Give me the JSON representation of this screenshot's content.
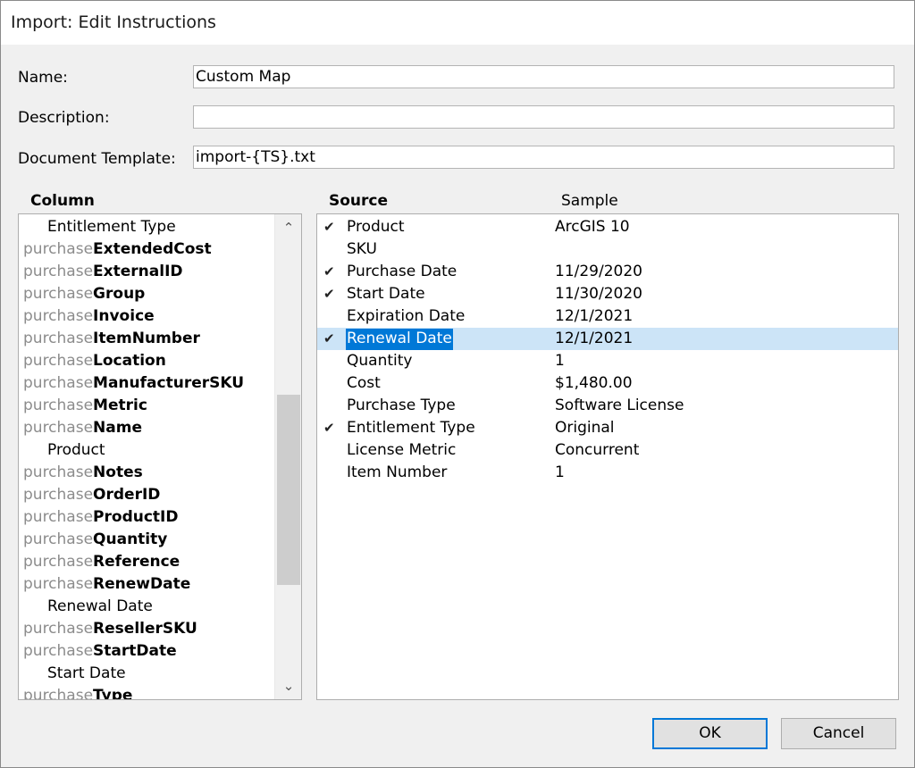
{
  "window": {
    "title": "Import: Edit Instructions"
  },
  "form": {
    "name_label": "Name:",
    "name_value": "Custom Map",
    "description_label": "Description:",
    "description_value": "",
    "template_label": "Document Template:",
    "template_value": "import-{TS}.txt"
  },
  "headers": {
    "column": "Column",
    "source": "Source",
    "sample": "Sample"
  },
  "column_list": [
    {
      "prefix": "",
      "field": "",
      "child": "Entitlement Type"
    },
    {
      "prefix": "purchase",
      "field": "ExtendedCost",
      "child": ""
    },
    {
      "prefix": "purchase",
      "field": "ExternalID",
      "child": ""
    },
    {
      "prefix": "purchase",
      "field": "Group",
      "child": ""
    },
    {
      "prefix": "purchase",
      "field": "Invoice",
      "child": ""
    },
    {
      "prefix": "purchase",
      "field": "ItemNumber",
      "child": ""
    },
    {
      "prefix": "purchase",
      "field": "Location",
      "child": ""
    },
    {
      "prefix": "purchase",
      "field": "ManufacturerSKU",
      "child": ""
    },
    {
      "prefix": "purchase",
      "field": "Metric",
      "child": ""
    },
    {
      "prefix": "purchase",
      "field": "Name",
      "child": ""
    },
    {
      "prefix": "",
      "field": "",
      "child": "Product"
    },
    {
      "prefix": "purchase",
      "field": "Notes",
      "child": ""
    },
    {
      "prefix": "purchase",
      "field": "OrderID",
      "child": ""
    },
    {
      "prefix": "purchase",
      "field": "ProductID",
      "child": ""
    },
    {
      "prefix": "purchase",
      "field": "Quantity",
      "child": ""
    },
    {
      "prefix": "purchase",
      "field": "Reference",
      "child": ""
    },
    {
      "prefix": "purchase",
      "field": "RenewDate",
      "child": ""
    },
    {
      "prefix": "",
      "field": "",
      "child": "Renewal Date"
    },
    {
      "prefix": "purchase",
      "field": "ResellerSKU",
      "child": ""
    },
    {
      "prefix": "purchase",
      "field": "StartDate",
      "child": ""
    },
    {
      "prefix": "",
      "field": "",
      "child": "Start Date"
    },
    {
      "prefix": "purchase",
      "field": "Type",
      "child": ""
    }
  ],
  "source_list": [
    {
      "checked": true,
      "source": "Product",
      "sample": "ArcGIS 10",
      "selected": false
    },
    {
      "checked": false,
      "source": "SKU",
      "sample": "",
      "selected": false
    },
    {
      "checked": true,
      "source": "Purchase Date",
      "sample": "11/29/2020",
      "selected": false
    },
    {
      "checked": true,
      "source": "Start Date",
      "sample": "11/30/2020",
      "selected": false
    },
    {
      "checked": false,
      "source": "Expiration Date",
      "sample": "12/1/2021",
      "selected": false
    },
    {
      "checked": true,
      "source": "Renewal Date",
      "sample": "12/1/2021",
      "selected": true
    },
    {
      "checked": false,
      "source": "Quantity",
      "sample": "1",
      "selected": false
    },
    {
      "checked": false,
      "source": "Cost",
      "sample": "$1,480.00",
      "selected": false
    },
    {
      "checked": false,
      "source": "Purchase Type",
      "sample": "Software License",
      "selected": false
    },
    {
      "checked": true,
      "source": "Entitlement Type",
      "sample": "Original",
      "selected": false
    },
    {
      "checked": false,
      "source": "License Metric",
      "sample": "Concurrent",
      "selected": false
    },
    {
      "checked": false,
      "source": "Item Number",
      "sample": "1",
      "selected": false
    }
  ],
  "icons": {
    "check": "✔",
    "scroll_up": "⌃",
    "scroll_down": "⌄"
  },
  "buttons": {
    "ok": "OK",
    "cancel": "Cancel"
  },
  "colors": {
    "selection_row": "#cce4f7",
    "selection_text": "#0078d7",
    "prefix_gray": "#8c8c8c"
  }
}
